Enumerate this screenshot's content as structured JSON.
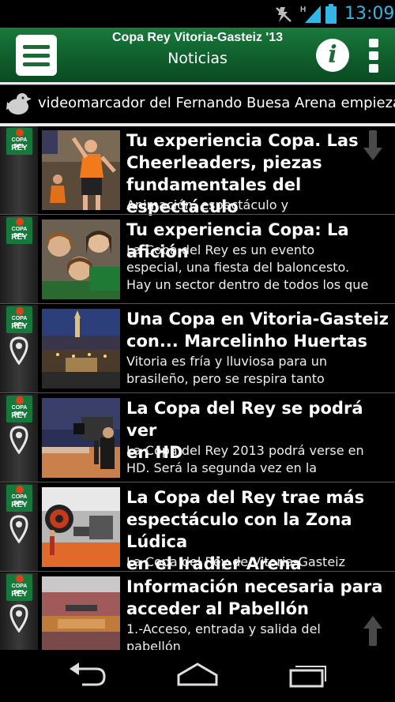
{
  "status_bar": {
    "time": "13:09",
    "network_label": "H",
    "icons": [
      "mute-icon",
      "signal-icon",
      "battery-icon"
    ]
  },
  "action_bar": {
    "title": "Copa Rey Vitoria-Gasteiz '13",
    "subtitle": "Noticias",
    "info_glyph": "i",
    "icons": [
      "menu-icon",
      "info-icon",
      "overflow-menu-icon"
    ]
  },
  "ticker": {
    "text": "videomarcador del Fernando Buesa Arena empieza"
  },
  "badge": {
    "line1": "COPA DEL",
    "line2": "REY"
  },
  "news": [
    {
      "title_lines": [
        "Tu experiencia Copa. Las",
        "Cheerleaders, piezas",
        "fundamentales del espectáculo"
      ],
      "desc_lines": [
        "Animación, espectáculo y"
      ],
      "has_pin": false,
      "thumb": "cheerleaders"
    },
    {
      "title_lines": [
        "Tu experiencia Copa: La afición"
      ],
      "desc_lines": [
        "La Copa del Rey es un evento",
        "especial, una fiesta del baloncesto.",
        "Hay un sector dentro de todos los que"
      ],
      "has_pin": false,
      "thumb": "fans"
    },
    {
      "title_lines": [
        "Una Copa en Vitoria-Gasteiz",
        "con... Marcelinho Huertas"
      ],
      "desc_lines": [
        "Vitoria es fría y lluviosa para un",
        "brasileño, pero se respira tanto"
      ],
      "has_pin": true,
      "thumb": "city-night"
    },
    {
      "title_lines": [
        "La Copa del Rey se podrá ver",
        "en HD"
      ],
      "desc_lines": [
        "La Copa del Rey 2013 podrá verse en",
        "HD. Será la segunda vez en la"
      ],
      "has_pin": true,
      "thumb": "tv-camera"
    },
    {
      "title_lines": [
        "La Copa del Rey trae más",
        "espectáculo con la Zona Lúdica",
        "en el Iradier Arena"
      ],
      "desc_lines": [
        "La Copa del Rey de Vitoria-Gasteiz"
      ],
      "has_pin": true,
      "thumb": "zona-ludica"
    },
    {
      "title_lines": [
        "Información necesaria para",
        "acceder al Pabellón"
      ],
      "desc_lines": [
        "1.-Acceso, entrada y salida del",
        "pabellón"
      ],
      "has_pin": true,
      "thumb": "arena"
    }
  ],
  "nav_bar": {
    "icons": [
      "back-icon",
      "home-icon",
      "recent-apps-icon"
    ]
  }
}
